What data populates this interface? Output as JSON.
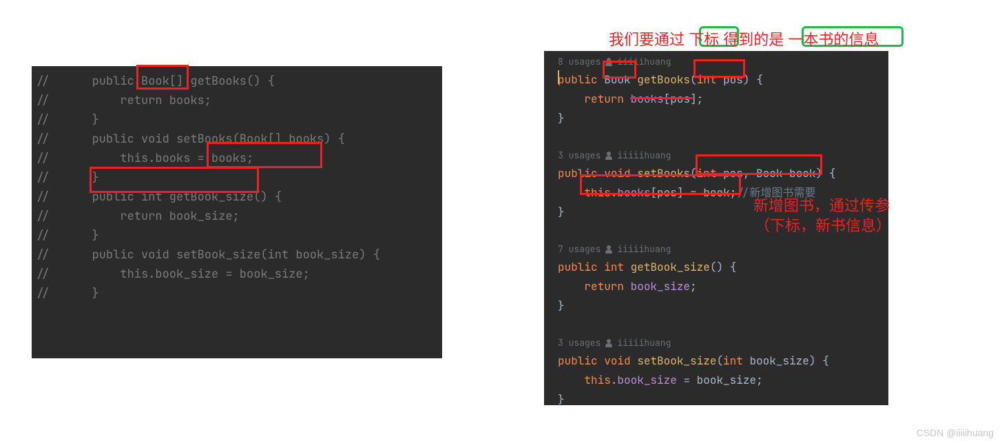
{
  "left": {
    "l1": "//      public Book[] getBooks() {",
    "l2": "//          return books;",
    "l3": "//      }",
    "l4": "",
    "l5": "//      public void setBooks(Book[] books) {",
    "l6": "//          this.books = books;",
    "l7": "//      }",
    "l8": "",
    "l9": "//      public int getBook_size() {",
    "l10": "//          return book_size;",
    "l11": "//      }",
    "l12": "",
    "l13": "//      public void setBook_size(int book_size) {",
    "l14": "//          this.book_size = book_size;",
    "l15": "//      }"
  },
  "right": {
    "usages1_a": "8 usages",
    "usages1_b": "iiiiihuang",
    "getBooks": {
      "kw_public": "public",
      "type": "Book",
      "name": "getBooks",
      "kw_int": "int",
      "param": "pos",
      "lbrace": "{",
      "kw_return": "return",
      "field": "books",
      "idx": "pos",
      "semi": ";",
      "rbrace": "}"
    },
    "usages2_a": "3 usages",
    "usages2_b": "iiiiihuang",
    "setBooks": {
      "kw_public": "public",
      "kw_void": "void",
      "name": "setBooks",
      "kw_int": "int",
      "p1": "pos",
      "type": "Book",
      "p2": "book",
      "lbrace": "{",
      "this": "this",
      "field": "books",
      "idx": "pos",
      "eq": "=",
      "val": "book",
      "semi": ";",
      "cmt": "//新增图书需要",
      "rbrace": "}"
    },
    "usages3_a": "7 usages",
    "usages3_b": "iiiiihuang",
    "getSize": {
      "kw_public": "public",
      "kw_int": "int",
      "name": "getBook_size",
      "lbrace": "{",
      "kw_return": "return",
      "field": "book_size",
      "semi": ";",
      "rbrace": "}"
    },
    "usages4_a": "3 usages",
    "usages4_b": "iiiiihuang",
    "setSize": {
      "kw_public": "public",
      "kw_void": "void",
      "name": "setBook_size",
      "kw_int": "int",
      "param": "book_size",
      "lbrace": "{",
      "this": "this",
      "field": "book_size",
      "eq": "=",
      "val": "book_size",
      "semi": ";",
      "rbrace": "}"
    }
  },
  "annot": {
    "top_left": "我们要通过",
    "top_green1": "下标",
    "top_mid": "得到的是",
    "top_green2": "一本书的信息",
    "r1": "新增图书，通过传参",
    "r2": "（下标，新书信息）"
  },
  "watermark": "CSDN @iiiiihuang"
}
